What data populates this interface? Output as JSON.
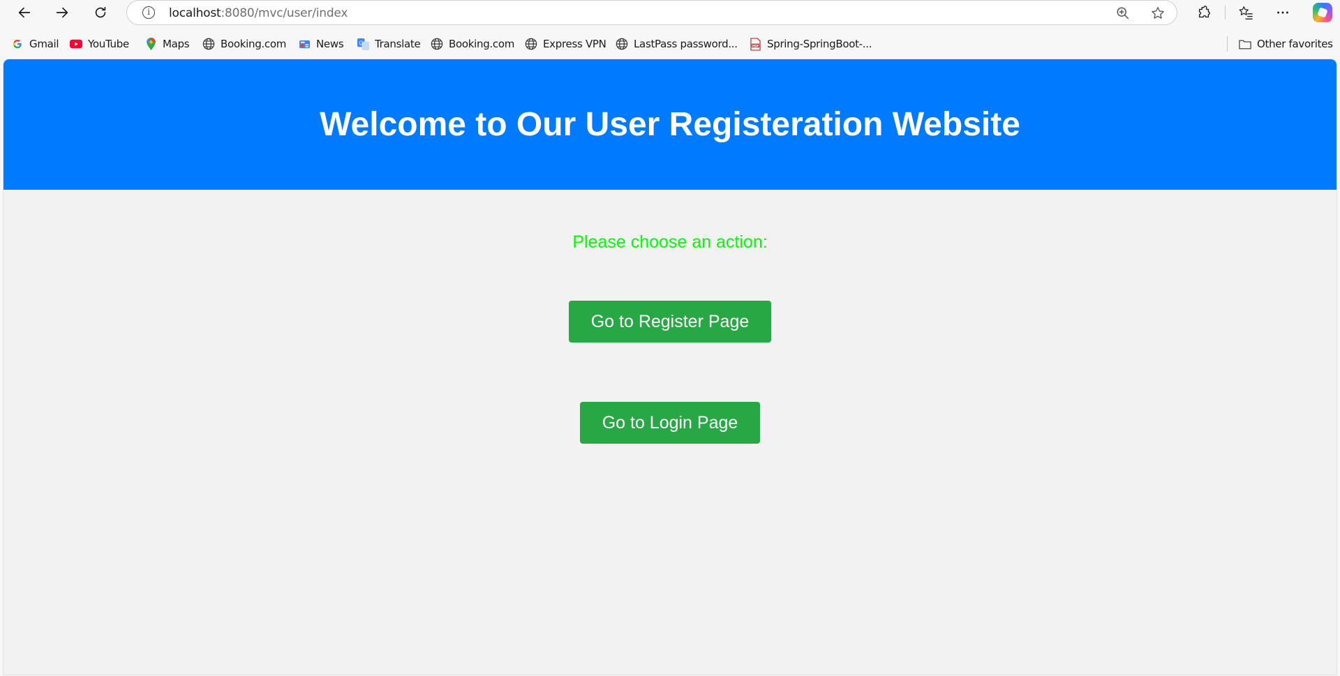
{
  "browser": {
    "url_host": "localhost",
    "url_path": ":8080/mvc/user/index"
  },
  "bookmarks": [
    {
      "label": "Gmail",
      "icon": "google-icon"
    },
    {
      "label": "YouTube",
      "icon": "youtube-icon"
    },
    {
      "label": "Maps",
      "icon": "maps-pin-icon"
    },
    {
      "label": "Booking.com",
      "icon": "globe-icon"
    },
    {
      "label": "News",
      "icon": "news-icon"
    },
    {
      "label": "Translate",
      "icon": "translate-icon"
    },
    {
      "label": "Booking.com",
      "icon": "globe-icon"
    },
    {
      "label": "Express VPN",
      "icon": "globe-icon"
    },
    {
      "label": "LastPass password...",
      "icon": "globe-icon"
    },
    {
      "label": "Spring-SpringBoot-...",
      "icon": "pdf-icon"
    }
  ],
  "other_favorites": "Other favorites",
  "page": {
    "heading": "Welcome to Our User Registeration Website",
    "prompt": "Please choose an action:",
    "register_button": "Go to Register Page",
    "login_button": "Go to Login Page"
  },
  "colors": {
    "header_bg": "#007bff",
    "prompt_text": "#00ff00",
    "button_bg": "#28a745",
    "page_bg": "#f2f2f2"
  }
}
